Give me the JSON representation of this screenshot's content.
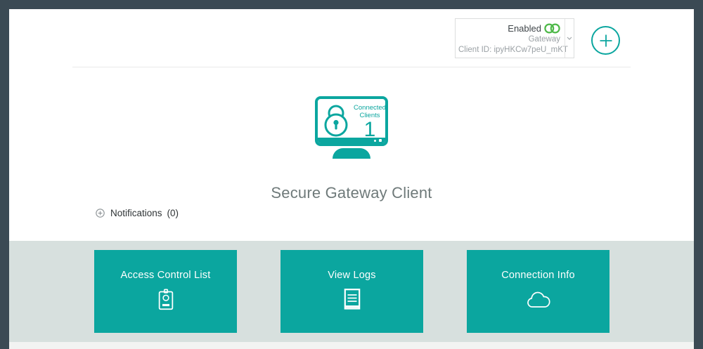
{
  "colors": {
    "accent": "#0ba69f",
    "green": "#4db848",
    "frame": "#3b4a54",
    "section": "#d7e0de"
  },
  "header": {
    "gateway_selector": {
      "status": "Enabled",
      "status_icon": "linked-rings-icon",
      "gateway_name": "Gateway",
      "client_id": "Client ID: ipyHKCw7peU_mKT",
      "dropdown_icon": "chevron-down-icon"
    },
    "add_button_icon": "plus-icon"
  },
  "hero": {
    "graphic_icons": [
      "monitor-icon",
      "padlock-icon"
    ],
    "connected_label": [
      "Connected",
      "Clients"
    ],
    "connected_count": "1",
    "title": "Secure Gateway Client"
  },
  "notifications": {
    "expand_icon": "circled-plus-icon",
    "label": "Notifications",
    "count": "(0)"
  },
  "actions": [
    {
      "label": "Access Control List",
      "icon": "id-badge-icon"
    },
    {
      "label": "View Logs",
      "icon": "log-document-icon"
    },
    {
      "label": "Connection Info",
      "icon": "cloud-icon"
    }
  ]
}
